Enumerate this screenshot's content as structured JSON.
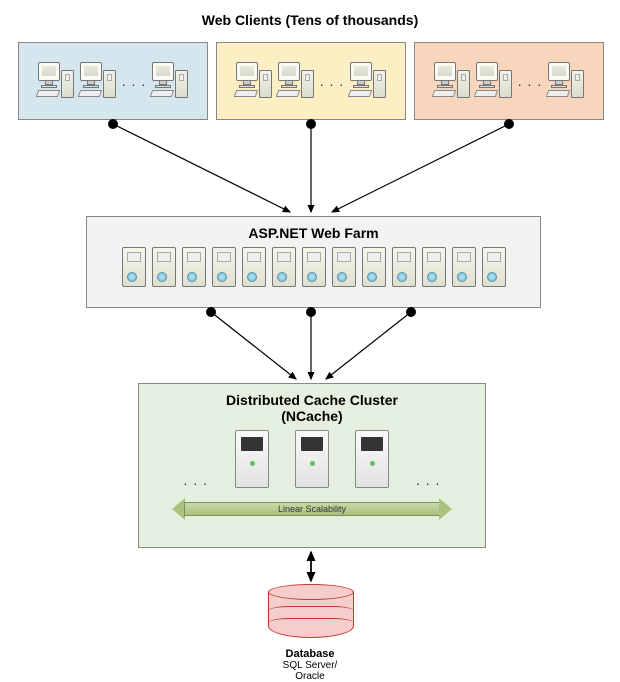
{
  "title": "Web Clients (Tens of thousands)",
  "ellipsis": ". . .",
  "farm": {
    "title": "ASP.NET Web Farm"
  },
  "cache": {
    "title1": "Distributed Cache Cluster",
    "title2": "(NCache)",
    "scalability": "Linear Scalability"
  },
  "database": {
    "title": "Database",
    "subtitle": "SQL Server/\nOracle"
  }
}
